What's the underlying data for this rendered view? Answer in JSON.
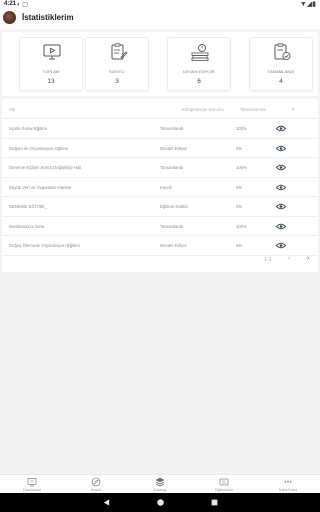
{
  "status_bar": {
    "time": "4:21",
    "left_icons": "◐ ▢",
    "right_icons": "▼◢▮"
  },
  "header": {
    "title": "İstatistiklerim",
    "avatar": "user-avatar-photo"
  },
  "stats": [
    {
      "label": "TOPLAM",
      "value": "13",
      "icon": "monitor-play-icon"
    },
    {
      "label": "KAYITLI",
      "value": "3",
      "icon": "clipboard-edit-icon"
    },
    {
      "label": "DEVAM EDİYOR",
      "value": "6",
      "icon": "hourglass-books-icon"
    },
    {
      "label": "TAMAMLANDI",
      "value": "4",
      "icon": "clipboard-check-icon"
    }
  ],
  "table": {
    "headers": {
      "name": "Adı",
      "status": "Kütüphaneye Durumu",
      "pct": "Tamamlanma",
      "action": "#"
    },
    "rows": [
      {
        "name": "Ispirla Sınav Eğitimi",
        "status": "Tamamlandı",
        "pct": "100%"
      },
      {
        "name": "Doğum ile Oryantasyon Eğitimi",
        "status": "Devam Ediyor",
        "pct": "0%"
      },
      {
        "name": "Deneme Eğitimi Sonra Değişikliği Hali",
        "status": "Tamamlandı",
        "pct": "100%"
      },
      {
        "name": "Büyük Veri ve Uygulama Alanları",
        "status": "Kayıtlı",
        "pct": "0%"
      },
      {
        "name": "DENEME EĞİTİMİ_",
        "status": "Eğitime Katıldı",
        "pct": "0%"
      },
      {
        "name": "Mevlanaxxxx Deta",
        "status": "Tamamlandı",
        "pct": "100%"
      },
      {
        "name": "Doğuş Ölemede Oryantasyon Eğitimi",
        "status": "Devam Ediyor",
        "pct": "0%"
      }
    ],
    "pagination": {
      "range": "1-3",
      "prev": "‹",
      "next": "›"
    }
  },
  "bottom_nav": [
    {
      "label": "Dashboard",
      "icon": "dashboard-icon"
    },
    {
      "label": "Keşfet",
      "icon": "compass-icon"
    },
    {
      "label": "Katalog",
      "icon": "layers-icon"
    },
    {
      "label": "Eğitimlerim",
      "icon": "course-icon"
    },
    {
      "label": "Daha Fazla",
      "icon": "more-icon"
    }
  ],
  "colors": {
    "accent": "#7b8ea3",
    "eye_icon": "#3a4a5a",
    "muted": "#b0b0b0"
  }
}
